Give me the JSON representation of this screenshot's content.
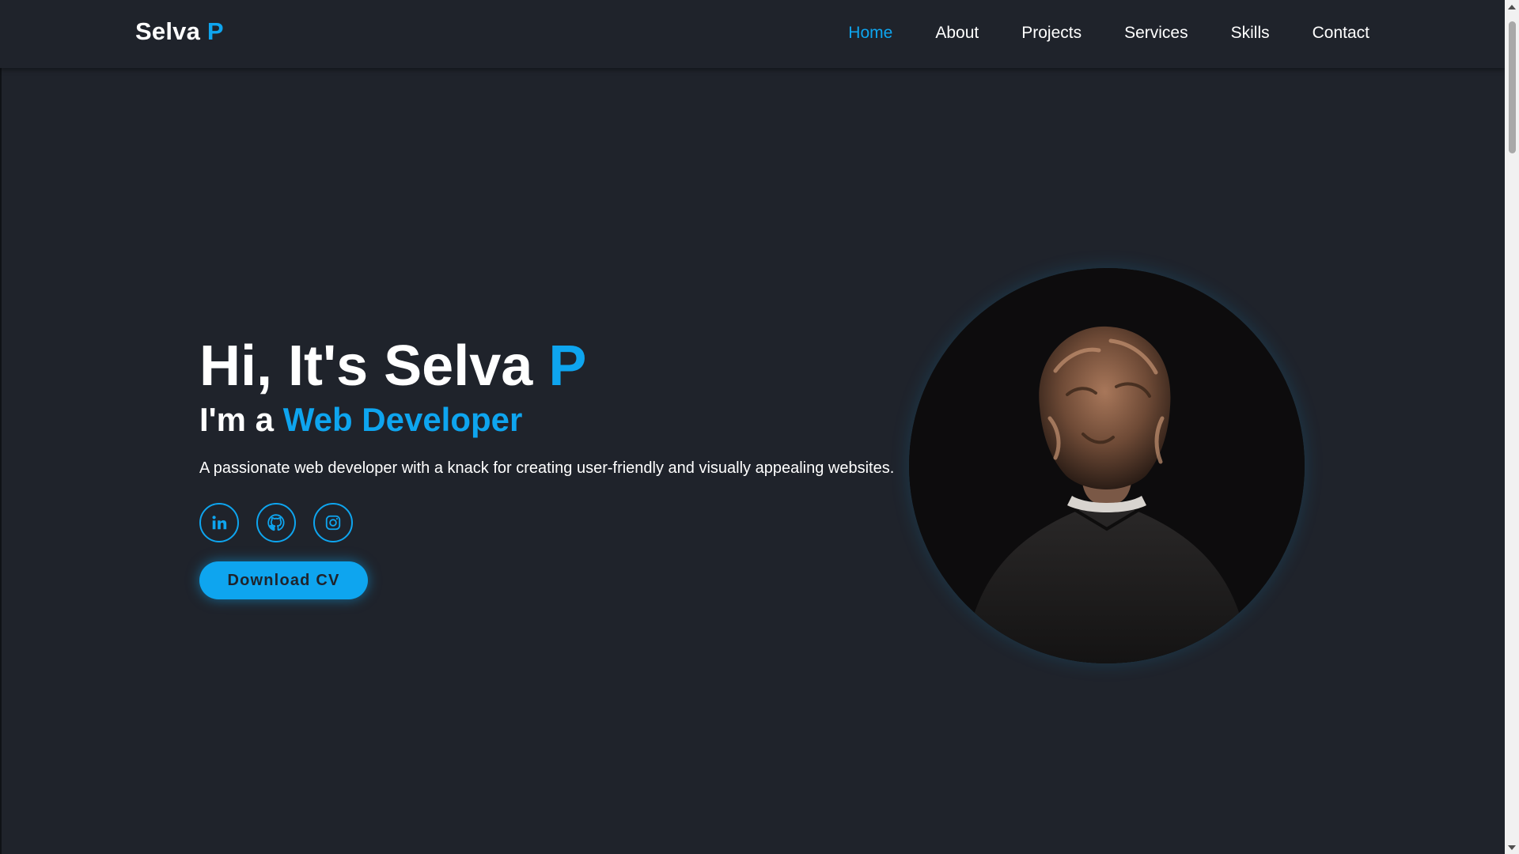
{
  "header": {
    "logo_main": "Selva ",
    "logo_accent": "P",
    "nav": [
      {
        "label": "Home",
        "active": true
      },
      {
        "label": "About",
        "active": false
      },
      {
        "label": "Projects",
        "active": false
      },
      {
        "label": "Services",
        "active": false
      },
      {
        "label": "Skills",
        "active": false
      },
      {
        "label": "Contact",
        "active": false
      }
    ]
  },
  "hero": {
    "title_main": "Hi, It's Selva ",
    "title_accent": "P",
    "subtitle_main": "I'm a ",
    "subtitle_accent": "Web Developer",
    "description": "A passionate web developer with a knack for creating user-friendly and visually appealing websites.",
    "socials": [
      {
        "icon": "linkedin-icon"
      },
      {
        "icon": "github-icon"
      },
      {
        "icon": "instagram-icon"
      }
    ],
    "cv_button": "Download CV"
  },
  "colors": {
    "accent": "#0ea5ef",
    "background": "#1f232b",
    "text": "#ffffff"
  }
}
